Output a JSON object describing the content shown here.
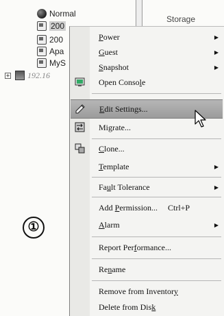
{
  "tree": {
    "items": [
      {
        "label": "Normal"
      },
      {
        "label": "200"
      },
      {
        "label": "200"
      },
      {
        "label": "Apa"
      },
      {
        "label": "MyS"
      }
    ],
    "host": {
      "expander": "+",
      "label": "192.16"
    }
  },
  "right_panel": {
    "header": "Storage"
  },
  "marker": {
    "text": "①"
  },
  "menu": {
    "power": {
      "label": "Power",
      "mnemonic": "P",
      "rest": "ower"
    },
    "guest": {
      "label": "Guest",
      "mnemonic": "G",
      "rest": "uest"
    },
    "snapshot": {
      "label": "Snapshot",
      "mnemonic": "S",
      "rest": "napshot"
    },
    "open_console": {
      "label": "Open Console",
      "pre": "Open Conso",
      "mnemonic": "l",
      "post": "e"
    },
    "edit_settings": {
      "label": "Edit Settings...",
      "mnemonic": "E",
      "rest": "dit Settings..."
    },
    "migrate": {
      "label": "Migrate...",
      "pre": "Mi",
      "mnemonic": "g",
      "post": "rate..."
    },
    "clone": {
      "label": "Clone...",
      "mnemonic": "C",
      "rest": "lone..."
    },
    "template": {
      "label": "Template",
      "mnemonic": "T",
      "rest": "emplate"
    },
    "fault_tolerance": {
      "label": "Fault Tolerance",
      "pre": "Fa",
      "mnemonic": "u",
      "post": "lt Tolerance"
    },
    "add_permission": {
      "label": "Add Permission...",
      "pre": "Add ",
      "mnemonic": "P",
      "post": "ermission...",
      "shortcut": "Ctrl+P"
    },
    "alarm": {
      "label": "Alarm",
      "mnemonic": "A",
      "rest": "larm"
    },
    "report_performance": {
      "label": "Report Performance...",
      "pre": "Report Per",
      "mnemonic": "f",
      "post": "ormance..."
    },
    "rename": {
      "label": "Rename",
      "pre": "Re",
      "mnemonic": "n",
      "post": "ame"
    },
    "remove_inventory": {
      "label": "Remove from Inventory",
      "pre": "Remove from Inventor",
      "mnemonic": "y",
      "post": ""
    },
    "delete_disk": {
      "label": "Delete from Disk",
      "pre": "Delete from Dis",
      "mnemonic": "k",
      "post": ""
    },
    "submenu_arrow": "▶"
  }
}
